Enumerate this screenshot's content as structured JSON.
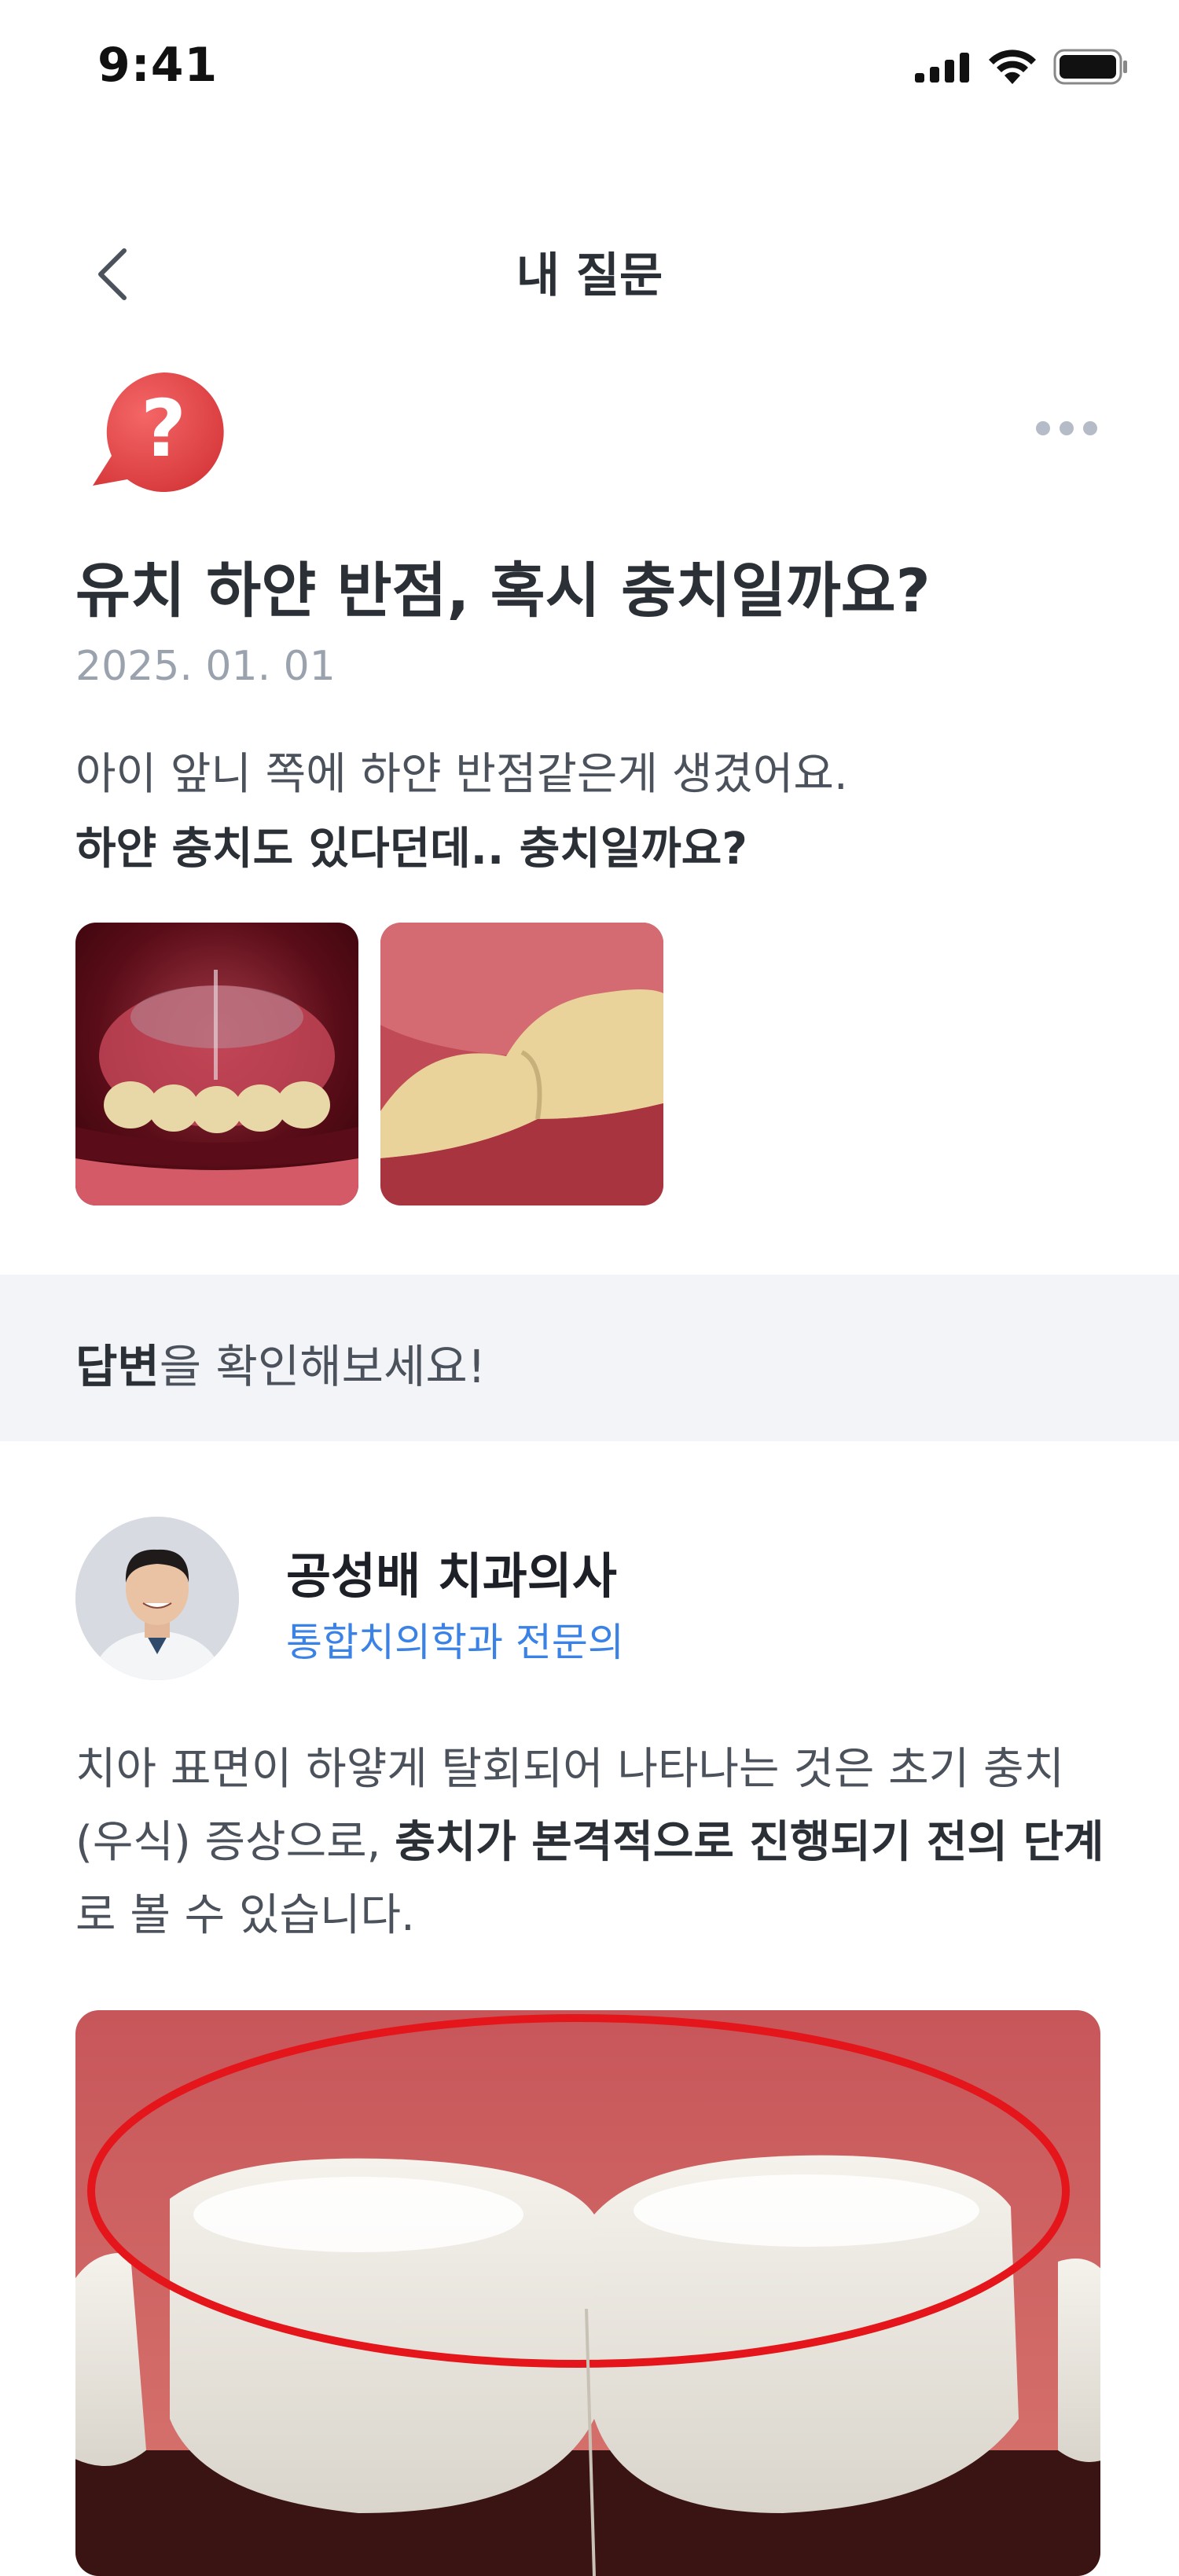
{
  "status_bar": {
    "time": "9:41"
  },
  "nav": {
    "title": "내 질문"
  },
  "question": {
    "title": "유치 하얀 반점, 혹시 충치일까요?",
    "date": "2025. 01. 01",
    "body_line1": "아이 앞니 쪽에 하얀 반점같은게 생겼어요.",
    "body_line2": "하얀 충치도 있다던데.. 충치일까요?"
  },
  "answer_banner": {
    "bold": "답변",
    "rest": "을 확인해보세요!"
  },
  "doctor": {
    "name": "공성배 치과의사",
    "specialty": "통합치의학과 전문의"
  },
  "answer": {
    "part1": "치아 표면이 하얗게 탈회되어 나타나는 것은 초기 충치(우식) 증상으로, ",
    "part2_bold": "충치가 본격적으로 진행되기 전의 단계",
    "part3": "로 볼 수 있습니다."
  },
  "colors": {
    "accent_blue": "#3b82e6",
    "banner_bg": "#f2f4f7",
    "question_icon_red": "#e8494b",
    "highlight_circle": "#e4161b"
  },
  "icons": [
    "signal-icon",
    "wifi-icon",
    "battery-icon",
    "back-chevron-icon",
    "question-bubble-icon",
    "more-dots-icon"
  ]
}
